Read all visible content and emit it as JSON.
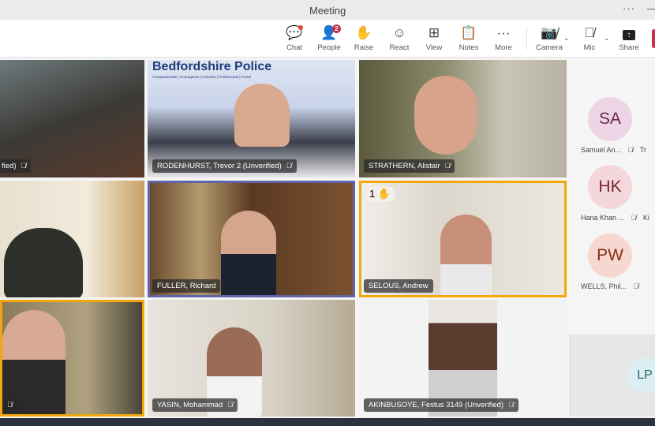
{
  "window": {
    "title": "Meeting",
    "more": "···"
  },
  "toolbar": {
    "chat": "Chat",
    "people": "People",
    "people_count": "2",
    "raise": "Raise",
    "react": "React",
    "view": "View",
    "notes": "Notes",
    "more": "More",
    "camera": "Camera",
    "mic": "Mic",
    "share": "Share"
  },
  "tiles": [
    {
      "name": "fied)"
    },
    {
      "name": "RODENHURST, Trevor 2 (Unverified)",
      "banner": "Bedfordshire Police",
      "tagline": "Compassionate | Courageous | Inclusive | Professional | Proud"
    },
    {
      "name": "STRATHERN, Alistair"
    },
    {
      "name": ""
    },
    {
      "name": "FULLER, Richard",
      "border": "#6264a7"
    },
    {
      "name": "SELOUS, Andrew",
      "border": "#f2a70d",
      "raise_count": "1"
    },
    {
      "name": "",
      "border": "#f2a70d"
    },
    {
      "name": "YASIN, Mohammad"
    },
    {
      "name": "AKINBUSOYE, Festus 3149 (Unverified)"
    }
  ],
  "sidebar": {
    "participants": [
      {
        "initials": "SA",
        "name": "Samuel An...",
        "color": "#ecd6e6",
        "text": "#6b2552",
        "next": "Tr"
      },
      {
        "initials": "HK",
        "name": "Hana Khan ...",
        "color": "#f4d7da",
        "text": "#7a2432",
        "next": "Ki"
      },
      {
        "initials": "PW",
        "name": "WELLS, Phil...",
        "color": "#f6d8d0",
        "text": "#8a2a14"
      }
    ],
    "featured": {
      "initials": "LP",
      "color": "#dcf0f4",
      "text": "#2a6470"
    }
  }
}
